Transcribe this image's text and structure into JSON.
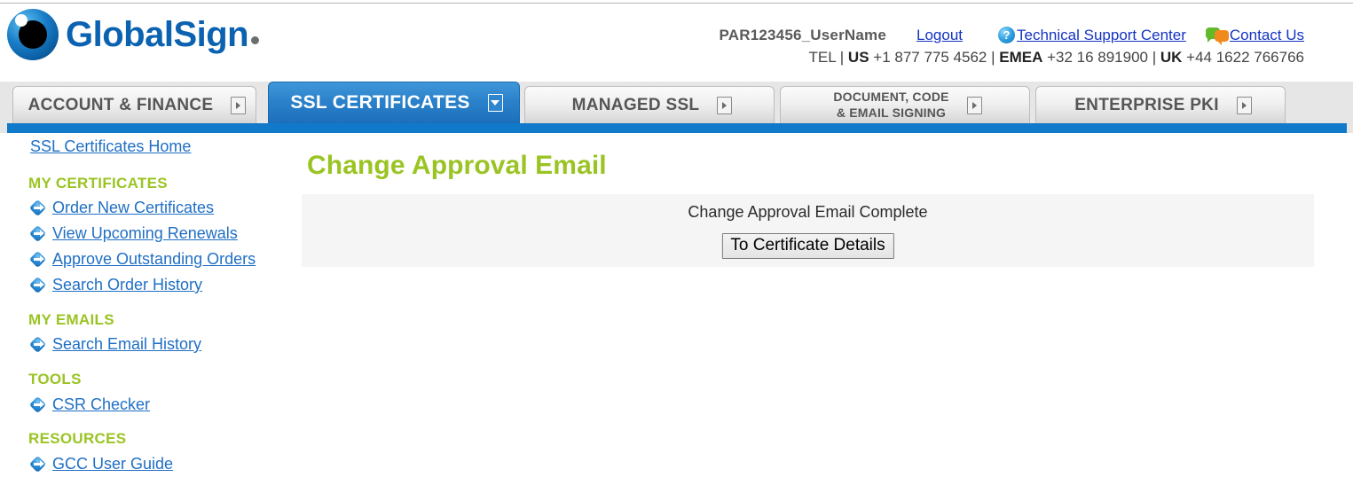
{
  "header": {
    "logo_text": "GlobalSign",
    "logo_icon": "globalsign-eye-logo",
    "username": "PAR123456_UserName",
    "logout_label": "Logout",
    "support_label": "Technical Support Center",
    "support_icon": "question-mark-icon",
    "contact_label": "Contact Us",
    "contact_icon": "speech-bubbles-icon",
    "tel_prefix": "TEL | ",
    "tel_us_label": "US",
    "tel_us_number": " +1 877 775 4562 | ",
    "tel_emea_label": "EMEA",
    "tel_emea_number": " +32 16 891900 | ",
    "tel_uk_label": "UK",
    "tel_uk_number": " +44 1622 766766"
  },
  "tabs": [
    {
      "label": "ACCOUNT & FINANCE",
      "icon": "arrow-right-icon",
      "active": false
    },
    {
      "label": "SSL CERTIFICATES",
      "icon": "arrow-down-icon",
      "active": true
    },
    {
      "label": "MANAGED SSL",
      "icon": "arrow-right-icon",
      "active": false
    },
    {
      "label": "DOCUMENT, CODE\n& EMAIL SIGNING",
      "line1": "DOCUMENT, CODE",
      "line2": "& EMAIL SIGNING",
      "icon": "arrow-right-icon",
      "active": false
    },
    {
      "label": "ENTERPRISE PKI",
      "icon": "arrow-right-icon",
      "active": false
    }
  ],
  "sidebar": {
    "home_label": "SSL Certificates Home",
    "sections": [
      {
        "title": "MY CERTIFICATES",
        "items": [
          {
            "label": "Order New Certificates"
          },
          {
            "label": "View Upcoming Renewals"
          },
          {
            "label": "Approve Outstanding Orders"
          },
          {
            "label": "Search Order History"
          }
        ]
      },
      {
        "title": "MY EMAILS",
        "items": [
          {
            "label": "Search Email History"
          }
        ]
      },
      {
        "title": "TOOLS",
        "items": [
          {
            "label": "CSR Checker"
          }
        ]
      },
      {
        "title": "RESOURCES",
        "items": [
          {
            "label": "GCC User Guide"
          }
        ]
      }
    ]
  },
  "main": {
    "page_title": "Change Approval Email",
    "status_message": "Change Approval Email Complete",
    "primary_button": "To Certificate Details"
  },
  "colors": {
    "brand_blue": "#0b62b0",
    "accent_green": "#9ac423",
    "link_blue": "#1f6fc4",
    "tab_active_blue": "#1d6fbb",
    "rule_blue": "#1179c9",
    "panel_gray": "#f5f5f5"
  }
}
